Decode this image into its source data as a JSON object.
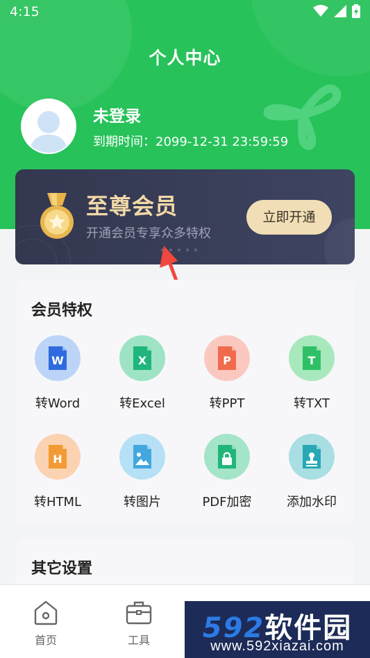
{
  "status_bar": {
    "time": "4:15"
  },
  "header": {
    "title": "个人中心"
  },
  "user": {
    "name": "未登录",
    "expire_text": "到期时间：2099-12-31 23:59:59"
  },
  "vip_card": {
    "title": "至尊会员",
    "subtitle": "开通会员专享众多特权",
    "button_label": "立即开通"
  },
  "privileges": {
    "title": "会员特权",
    "items": [
      {
        "label": "转Word",
        "icon": "word-file-icon",
        "bg": "#bcd4f7",
        "fg": "#2f6bde",
        "glyph": "W"
      },
      {
        "label": "转Excel",
        "icon": "excel-file-icon",
        "bg": "#9ee3c4",
        "fg": "#1fb57d",
        "glyph": "X"
      },
      {
        "label": "转PPT",
        "icon": "ppt-file-icon",
        "bg": "#fbc8bf",
        "fg": "#f06a4e",
        "glyph": "P"
      },
      {
        "label": "转TXT",
        "icon": "txt-file-icon",
        "bg": "#a8e8bd",
        "fg": "#2fc067",
        "glyph": "T"
      },
      {
        "label": "转HTML",
        "icon": "html-file-icon",
        "bg": "#fbd3b2",
        "fg": "#f39a35",
        "glyph": "H"
      },
      {
        "label": "转图片",
        "icon": "image-file-icon",
        "bg": "#b6e0f6",
        "fg": "#43a7de",
        "glyph": ""
      },
      {
        "label": "PDF加密",
        "icon": "lock-file-icon",
        "bg": "#a4e4c8",
        "fg": "#22b579",
        "glyph": ""
      },
      {
        "label": "添加水印",
        "icon": "stamp-file-icon",
        "bg": "#a9dee3",
        "fg": "#27a9b4",
        "glyph": ""
      }
    ]
  },
  "other_settings": {
    "title": "其它设置"
  },
  "tabbar": {
    "home_label": "首页",
    "tools_label": "工具"
  },
  "watermark": {
    "brand_digits": "592",
    "brand_cn": "软件园",
    "url": "www.592xiazai.com"
  },
  "colors": {
    "primary_green": "#27c25a",
    "vip_dark": "#373c56",
    "vip_gold": "#f2d9a7"
  }
}
